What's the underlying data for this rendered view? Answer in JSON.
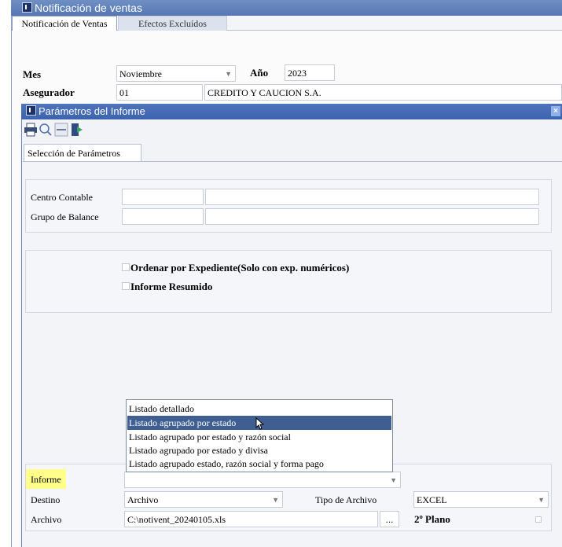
{
  "window": {
    "title": "Notificación de ventas",
    "tabs": [
      "Notificación de Ventas",
      "Efectos Excluídos"
    ]
  },
  "header_form": {
    "mes_label": "Mes",
    "mes_value": "Noviembre",
    "anio_label": "Año",
    "anio_value": "2023",
    "asegurador_label": "Asegurador",
    "asegurador_code": "01",
    "asegurador_name": "CREDITO Y CAUCION S.A."
  },
  "dialog": {
    "title": "Parámetros del Informe",
    "toolbar": [
      "printer-icon",
      "search-icon",
      "minus-icon",
      "exit-icon"
    ],
    "tab": "Selección de Parámetros",
    "centro_contable_label": "Centro Contable",
    "grupo_balance_label": "Grupo de Balance",
    "ordenar_label": "Ordenar  por Expediente(Solo con exp. numéricos)",
    "resumido_label": "Informe Resumido",
    "informe_label": "Informe",
    "informe_options": [
      "Listado detallado",
      "Listado agrupado por estado",
      "Listado agrupado por estado y razón social",
      "Listado agrupado por estado y divisa",
      "Listado agrupado estado, razón social y forma pago"
    ],
    "informe_selected_index": 1,
    "destino_label": "Destino",
    "destino_value": "Archivo",
    "tipo_archivo_label": "Tipo de Archivo",
    "tipo_archivo_value": "EXCEL",
    "archivo_label": "Archivo",
    "archivo_value": "C:\\notivent_20240105.xls",
    "browse_label": "...",
    "segundo_plano_label": "2º Plano"
  },
  "colors": {
    "title_bar": "#5577b2",
    "dialog_title": "#3c63ad",
    "selected_item": "#3f5f92",
    "highlight": "#ffff8a"
  }
}
